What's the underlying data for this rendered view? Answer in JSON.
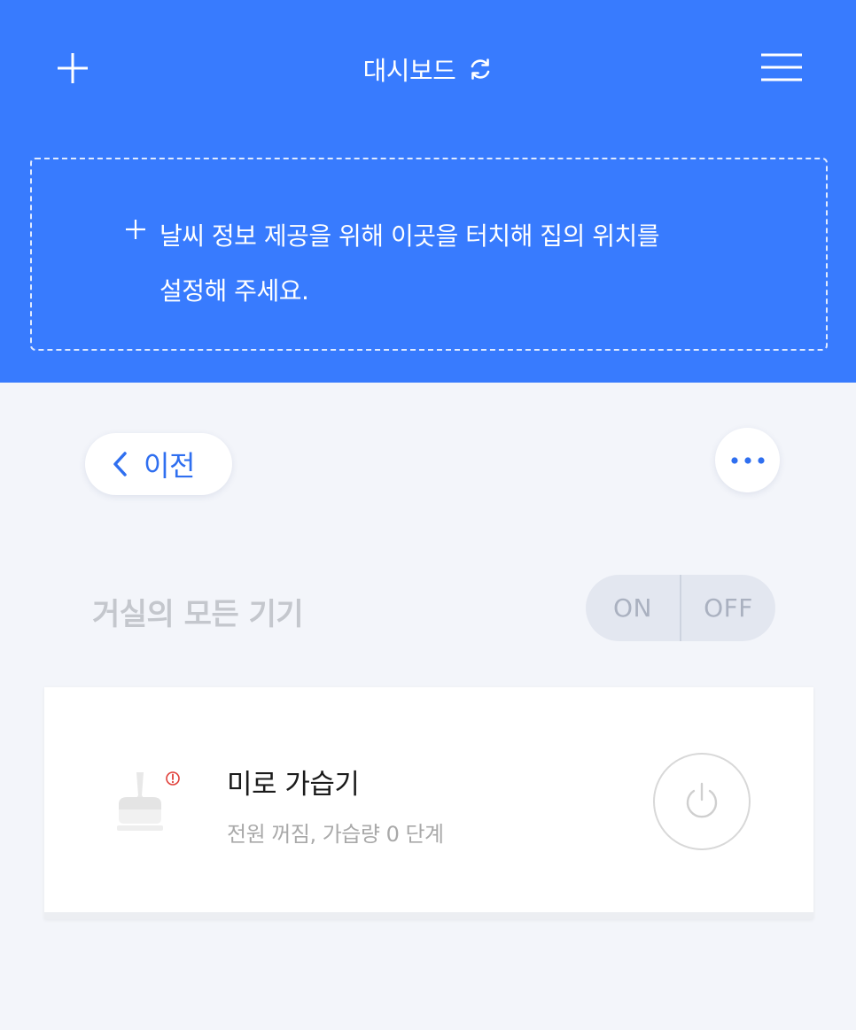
{
  "header": {
    "title": "대시보드",
    "add_icon": "plus-icon",
    "refresh_icon": "refresh-icon",
    "menu_icon": "hamburger-menu-icon",
    "background_color": "#387bfe"
  },
  "weather": {
    "line1": "날씨 정보 제공을 위해 이곳을 터치해 집의 위치를",
    "line2": "설정해 주세요.",
    "icon": "plus-icon"
  },
  "nav": {
    "back_label": "이전",
    "back_icon": "chevron-left-icon",
    "more_icon": "more-horizontal-icon",
    "accent_color": "#2f6ff0"
  },
  "room": {
    "title": "거실의 모든 기기",
    "on_label": "ON",
    "off_label": "OFF"
  },
  "device": {
    "name": "미로 가습기",
    "status": "전원 꺼짐, 가습량 0 단계",
    "image_icon": "humidifier-icon",
    "alert_icon": "alert-icon",
    "power_icon": "power-icon",
    "alert_color": "#e0403a"
  }
}
